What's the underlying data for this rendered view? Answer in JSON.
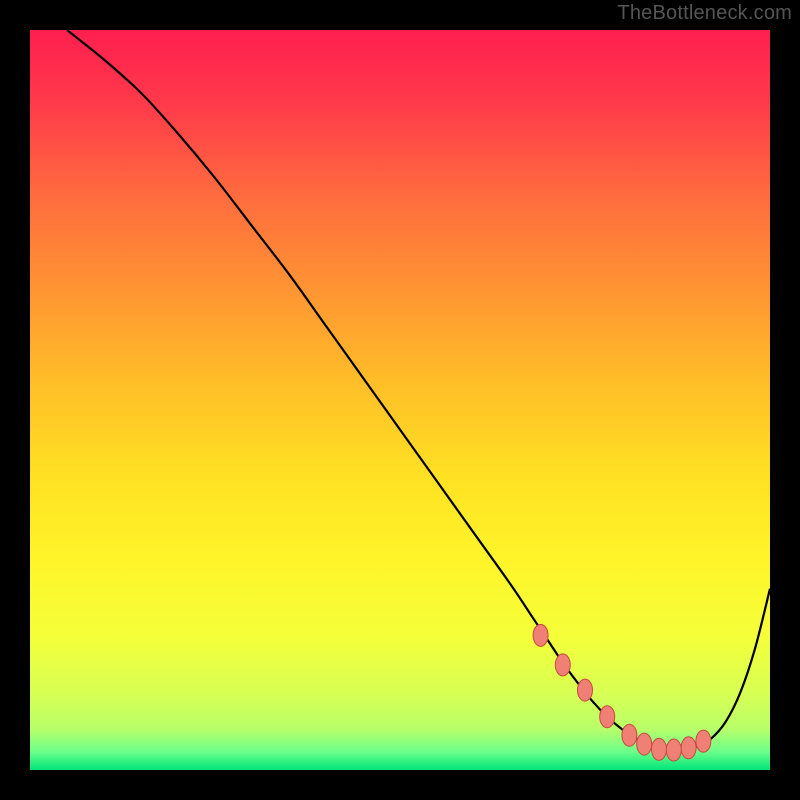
{
  "watermark": "TheBottleneck.com",
  "colors": {
    "bg": "#000000",
    "watermark": "#555555",
    "curve": "#000000",
    "dots_fill": "#f08075",
    "dots_stroke": "#c54a3f",
    "grad_stops": [
      {
        "offset": 0.0,
        "color": "#ff1f4f"
      },
      {
        "offset": 0.1,
        "color": "#ff3a4a"
      },
      {
        "offset": 0.22,
        "color": "#ff6a3f"
      },
      {
        "offset": 0.35,
        "color": "#ff9433"
      },
      {
        "offset": 0.48,
        "color": "#ffbf28"
      },
      {
        "offset": 0.6,
        "color": "#ffe023"
      },
      {
        "offset": 0.72,
        "color": "#fff52a"
      },
      {
        "offset": 0.82,
        "color": "#f4ff3a"
      },
      {
        "offset": 0.9,
        "color": "#d6ff55"
      },
      {
        "offset": 0.945,
        "color": "#b8ff6a"
      },
      {
        "offset": 0.975,
        "color": "#6dff8a"
      },
      {
        "offset": 1.0,
        "color": "#00e57a"
      }
    ]
  },
  "chart_data": {
    "type": "line",
    "title": "",
    "xlabel": "",
    "ylabel": "",
    "xlim": [
      0,
      100
    ],
    "ylim": [
      0,
      100
    ],
    "series": [
      {
        "name": "curve",
        "x": [
          5,
          10,
          15,
          20,
          25,
          30,
          35,
          40,
          45,
          50,
          55,
          60,
          65,
          68,
          70,
          72,
          74,
          76,
          78,
          80,
          82,
          84,
          86,
          88,
          90,
          92,
          94,
          96,
          98,
          100
        ],
        "y": [
          100,
          96,
          91.5,
          86,
          80,
          73.5,
          67,
          60,
          53,
          46,
          39,
          32,
          25,
          20.5,
          17.5,
          14.5,
          11.8,
          9.3,
          7.2,
          5.5,
          4.2,
          3.3,
          2.8,
          2.7,
          3.1,
          4.2,
          6.5,
          10.5,
          16.5,
          24.5
        ]
      }
    ],
    "highlight_points": {
      "name": "optimal-region-dots",
      "x": [
        69,
        72,
        75,
        78,
        81,
        83,
        85,
        87,
        89,
        91
      ],
      "y": [
        18.2,
        14.2,
        10.8,
        7.2,
        4.7,
        3.5,
        2.8,
        2.7,
        3.0,
        3.9
      ]
    }
  }
}
